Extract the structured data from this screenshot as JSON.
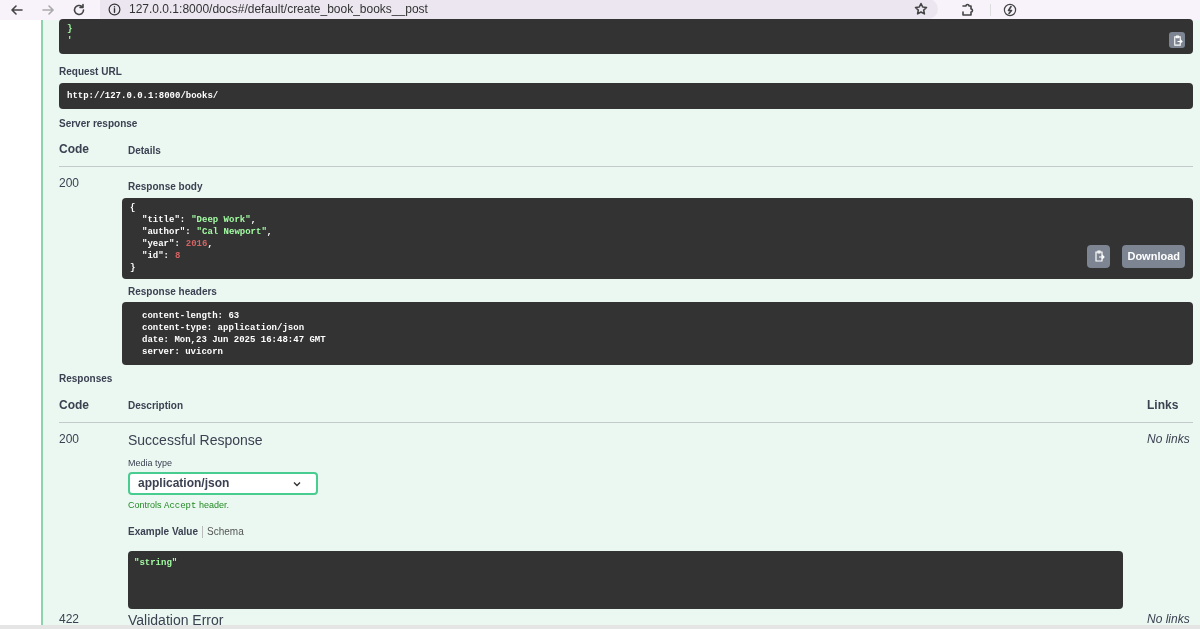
{
  "browser": {
    "url": "127.0.0.1:8000/docs#/default/create_book_books__post"
  },
  "request_body_tail": {
    "lines": [
      "}",
      "'"
    ]
  },
  "request_url": {
    "label": "Request URL",
    "value": "http://127.0.0.1:8000/books/"
  },
  "server_response": {
    "label": "Server response",
    "columns": [
      "Code",
      "Details"
    ],
    "code": "200",
    "body_label": "Response body",
    "body": [
      {
        "kind": "punct",
        "text": "{"
      },
      {
        "kind": "string",
        "key": "\"title\":",
        "value": "\"Deep Work\"",
        "comma": ","
      },
      {
        "kind": "string",
        "key": "\"author\":",
        "value": "\"Cal Newport\"",
        "comma": ","
      },
      {
        "kind": "number",
        "key": "\"year\":",
        "value": "2016",
        "comma": ","
      },
      {
        "kind": "number",
        "key": "\"id\":",
        "value": "8"
      },
      {
        "kind": "punct",
        "text": "}"
      }
    ],
    "download_label": "Download",
    "headers_label": "Response headers",
    "headers": [
      "content-length: 63",
      "content-type: application/json",
      "date: Mon,23 Jun 2025 16:48:47 GMT",
      "server: uvicorn"
    ]
  },
  "responses": {
    "label": "Responses",
    "columns": [
      "Code",
      "Description",
      "Links"
    ],
    "rows": [
      {
        "code": "200",
        "description": "Successful Response",
        "links": "No links",
        "media_type_label": "Media type",
        "media_type": "application/json",
        "controls_note": "Controls **Accept** header.",
        "tabs": [
          {
            "label": "Example Value",
            "selected": true
          },
          {
            "label": "Schema",
            "selected": false
          }
        ],
        "example": "\"string\""
      },
      {
        "code": "422",
        "description": "Validation Error",
        "links": "No links"
      }
    ]
  }
}
